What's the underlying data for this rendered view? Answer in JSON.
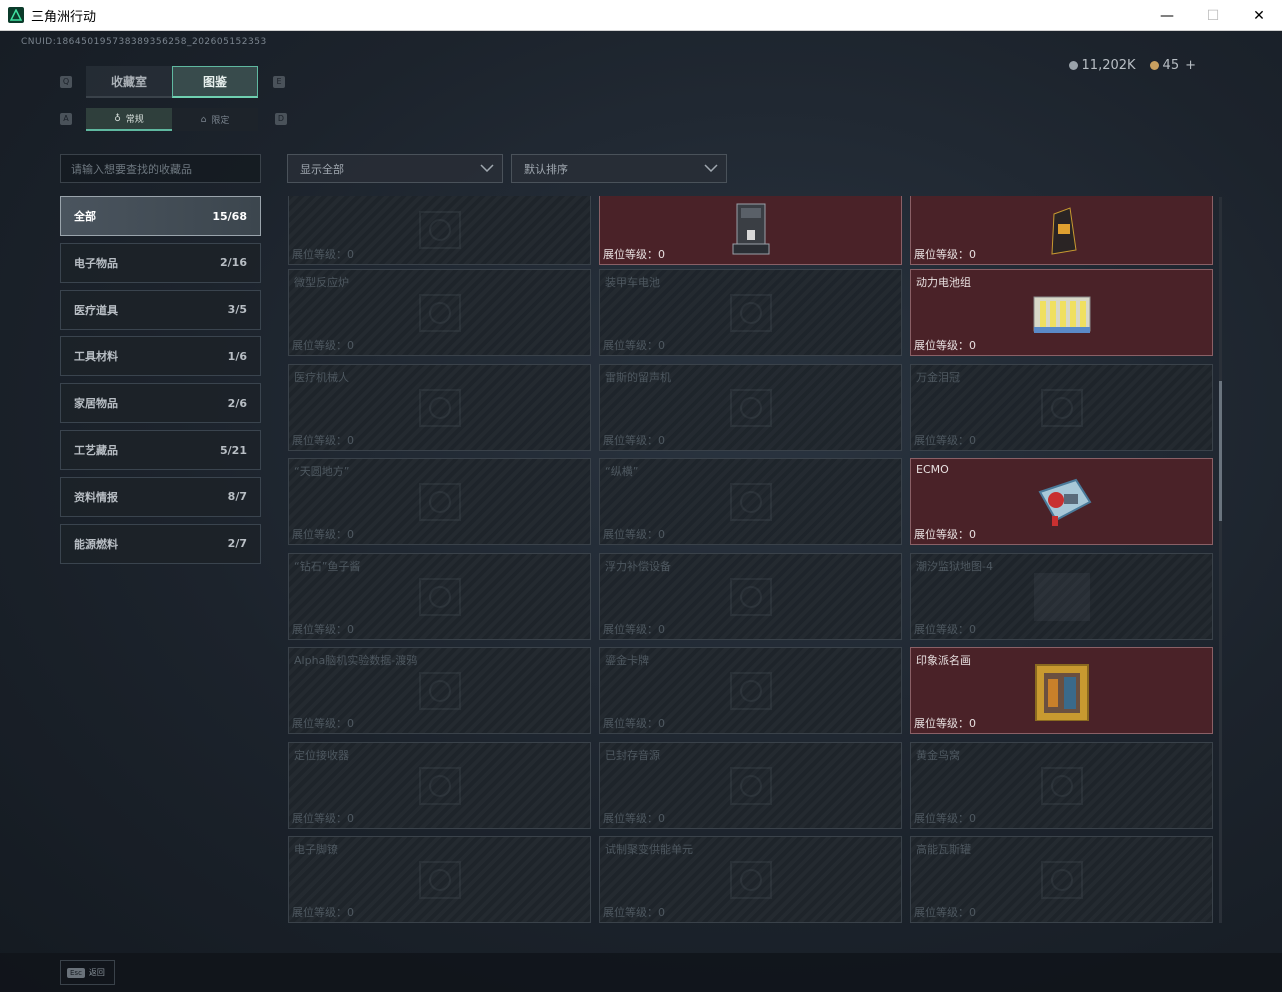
{
  "window": {
    "title": "三角洲行动",
    "minimize": "—",
    "maximize": "☐",
    "close": "✕"
  },
  "uid": "CNUID:186450195738389356258_202605152353",
  "currency": [
    {
      "value": "11,202K",
      "color": "#9aa2aa"
    },
    {
      "value": "45",
      "color": "#c8a060",
      "plus": "+"
    }
  ],
  "tabs": [
    {
      "label": "收藏室",
      "active": false
    },
    {
      "label": "图鉴",
      "active": true
    }
  ],
  "tab_keys": {
    "left": "Q",
    "right": "E"
  },
  "subtabs": [
    {
      "label": "常规",
      "active": true
    },
    {
      "label": "限定",
      "active": false
    }
  ],
  "subtab_keys": {
    "left": "A",
    "right": "D"
  },
  "search": {
    "placeholder": "请输入想要查找的收藏品"
  },
  "categories": [
    {
      "label": "全部",
      "count": "15/68",
      "active": true
    },
    {
      "label": "电子物品",
      "count": "2/16"
    },
    {
      "label": "医疗道具",
      "count": "3/5"
    },
    {
      "label": "工具材料",
      "count": "1/6"
    },
    {
      "label": "家居物品",
      "count": "2/6"
    },
    {
      "label": "工艺藏品",
      "count": "5/21"
    },
    {
      "label": "资料情报",
      "count": "8/7"
    },
    {
      "label": "能源燃料",
      "count": "2/7"
    }
  ],
  "filters": {
    "show": "显示全部",
    "sort": "默认排序"
  },
  "items": [
    {
      "name": "",
      "level": "展位等级：0",
      "owned": false,
      "icon": "box-icon"
    },
    {
      "name": "",
      "level": "展位等级：0",
      "owned": true,
      "icon": "coffee-machine-icon"
    },
    {
      "name": "",
      "level": "展位等级：0",
      "owned": true,
      "icon": "coffee-bag-icon"
    },
    {
      "name": "微型反应炉",
      "level": "展位等级：0",
      "owned": false,
      "icon": "reactor-icon"
    },
    {
      "name": "装甲车电池",
      "level": "展位等级：0",
      "owned": false,
      "icon": "battery-icon"
    },
    {
      "name": "动力电池组",
      "level": "展位等级：0",
      "owned": true,
      "icon": "battery-pack-icon"
    },
    {
      "name": "医疗机械人",
      "level": "展位等级：0",
      "owned": false,
      "icon": "robot-icon"
    },
    {
      "name": "雷斯的留声机",
      "level": "展位等级：0",
      "owned": false,
      "icon": "gramophone-icon"
    },
    {
      "name": "万金泪冠",
      "level": "展位等级：0",
      "owned": false,
      "icon": "crown-icon"
    },
    {
      "name": "“天圆地方”",
      "level": "展位等级：0",
      "owned": false,
      "icon": "globe-icon"
    },
    {
      "name": "“纵横”",
      "level": "展位等级：0",
      "owned": false,
      "icon": "board-icon"
    },
    {
      "name": "ECMO",
      "level": "展位等级：0",
      "owned": true,
      "icon": "ecmo-icon"
    },
    {
      "name": "“钻石”鱼子酱",
      "level": "展位等级：0",
      "owned": false,
      "icon": "caviar-icon"
    },
    {
      "name": "浮力补偿设备",
      "level": "展位等级：0",
      "owned": false,
      "icon": "diving-gear-icon"
    },
    {
      "name": "潮汐监狱地图-4",
      "level": "展位等级：0",
      "owned": false,
      "icon": "map-icon"
    },
    {
      "name": "Alpha脑机实验数据-渡鸦",
      "level": "展位等级：0",
      "owned": false,
      "icon": "data-drive-icon"
    },
    {
      "name": "鎏金卡牌",
      "level": "展位等级：0",
      "owned": false,
      "icon": "card-icon"
    },
    {
      "name": "印象派名画",
      "level": "展位等级：0",
      "owned": true,
      "icon": "painting-icon"
    },
    {
      "name": "定位接收器",
      "level": "展位等级：0",
      "owned": false,
      "icon": "receiver-icon"
    },
    {
      "name": "已封存音源",
      "level": "展位等级：0",
      "owned": false,
      "icon": "audio-icon"
    },
    {
      "name": "黄金鸟窝",
      "level": "展位等级：0",
      "owned": false,
      "icon": "nest-icon"
    },
    {
      "name": "电子脚镣",
      "level": "展位等级：0",
      "owned": false,
      "icon": "anklet-icon"
    },
    {
      "name": "试制聚变供能单元",
      "level": "展位等级：0",
      "owned": false,
      "icon": "fusion-icon"
    },
    {
      "name": "高能瓦斯罐",
      "level": "展位等级：0",
      "owned": false,
      "icon": "gas-tank-icon"
    }
  ],
  "bottom": {
    "key": "Esc",
    "label": "返回"
  }
}
